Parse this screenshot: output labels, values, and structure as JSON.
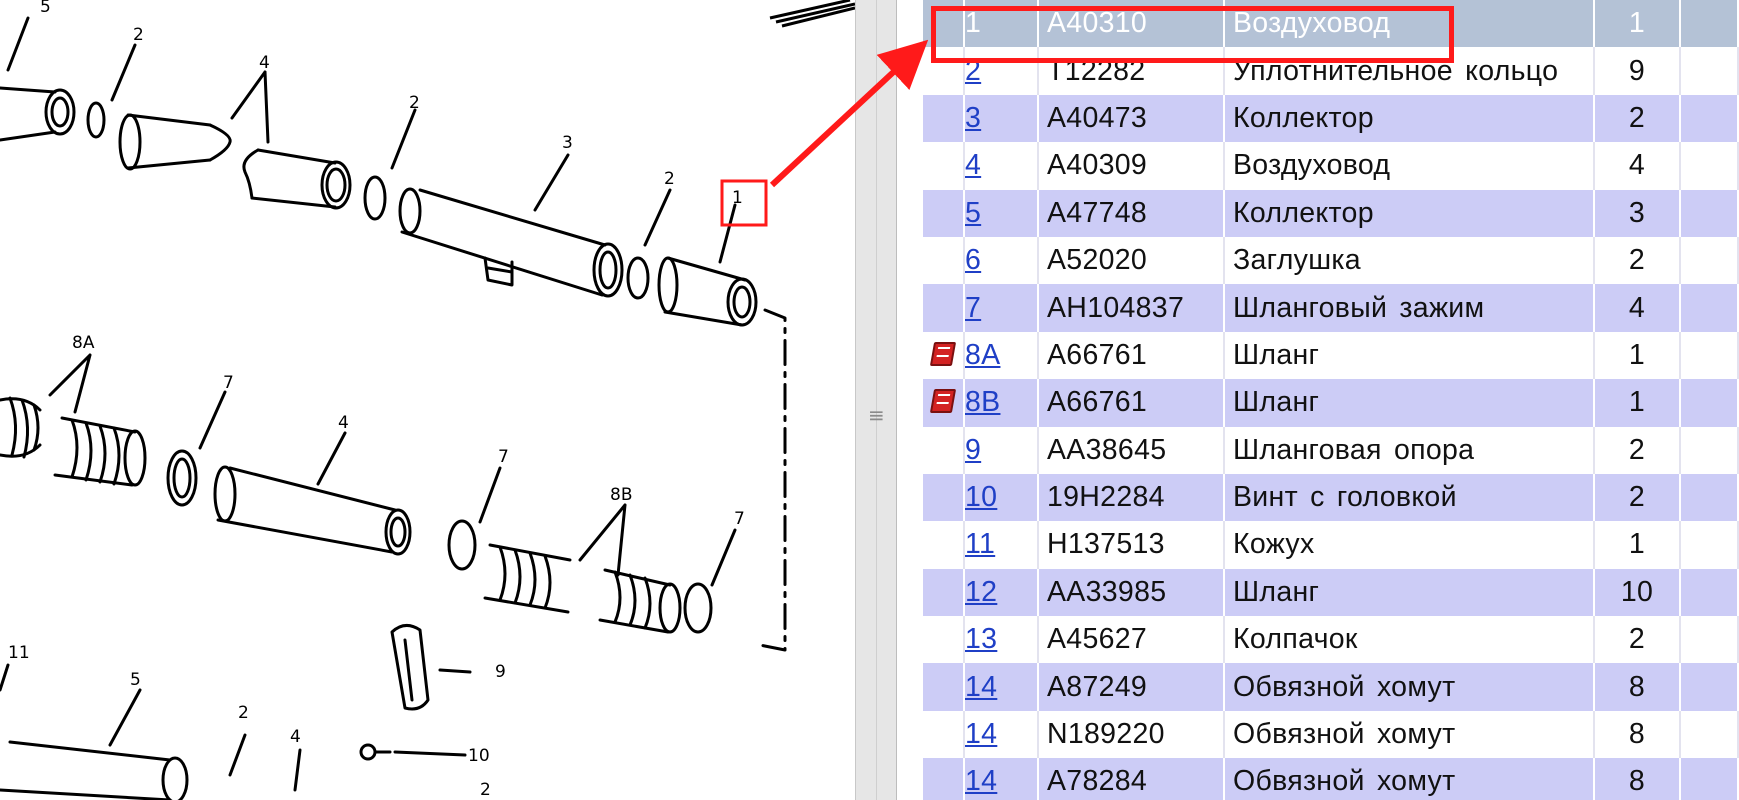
{
  "diagram": {
    "callouts": [
      "5",
      "2",
      "4",
      "2",
      "3",
      "2",
      "1",
      "8A",
      "7",
      "4",
      "7",
      "8B",
      "7",
      "9",
      "10",
      "11",
      "5",
      "2",
      "4",
      "2"
    ]
  },
  "parts_table": {
    "selected_row_index": 0,
    "rows": [
      {
        "pos": "1",
        "number": "A40310",
        "name": "Воздуховод",
        "qty": "1",
        "icon": ""
      },
      {
        "pos": "2",
        "number": "T12282",
        "name": "Уплотнительное кольцо",
        "qty": "9",
        "icon": ""
      },
      {
        "pos": "3",
        "number": "A40473",
        "name": "Коллектор",
        "qty": "2",
        "icon": ""
      },
      {
        "pos": "4",
        "number": "A40309",
        "name": "Воздуховод",
        "qty": "4",
        "icon": ""
      },
      {
        "pos": "5",
        "number": "A47748",
        "name": "Коллектор",
        "qty": "3",
        "icon": ""
      },
      {
        "pos": "6",
        "number": "A52020",
        "name": "Заглушка",
        "qty": "2",
        "icon": ""
      },
      {
        "pos": "7",
        "number": "AH104837",
        "name": "Шланговый зажим",
        "qty": "4",
        "icon": ""
      },
      {
        "pos": "8A",
        "number": "A66761",
        "name": "Шланг",
        "qty": "1",
        "icon": "bookmark-icon"
      },
      {
        "pos": "8B",
        "number": "A66761",
        "name": "Шланг",
        "qty": "1",
        "icon": "bookmark-icon"
      },
      {
        "pos": "9",
        "number": "AA38645",
        "name": "Шланговая опора",
        "qty": "2",
        "icon": ""
      },
      {
        "pos": "10",
        "number": "19H2284",
        "name": "Винт с головкой",
        "qty": "2",
        "icon": ""
      },
      {
        "pos": "11",
        "number": "H137513",
        "name": "Кожух",
        "qty": "1",
        "icon": ""
      },
      {
        "pos": "12",
        "number": "AA33985",
        "name": "Шланг",
        "qty": "10",
        "icon": ""
      },
      {
        "pos": "13",
        "number": "A45627",
        "name": "Колпачок",
        "qty": "2",
        "icon": ""
      },
      {
        "pos": "14",
        "number": "A87249",
        "name": "Обвязной хомут",
        "qty": "8",
        "icon": ""
      },
      {
        "pos": "14",
        "number": "N189220",
        "name": "Обвязной хомут",
        "qty": "8",
        "icon": ""
      },
      {
        "pos": "14",
        "number": "A78284",
        "name": "Обвязной хомут",
        "qty": "8",
        "icon": ""
      }
    ]
  },
  "colors": {
    "row_stripe": "#ccccf6",
    "selected_row": "#b4c2d6",
    "link": "#1f3fc6",
    "highlight": "#ff1a1a"
  }
}
